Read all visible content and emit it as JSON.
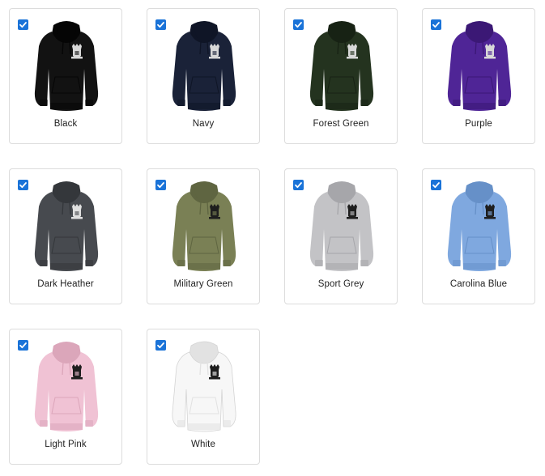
{
  "swatches": [
    {
      "label": "Black",
      "selected": true,
      "color": "#121212",
      "shade": "#050505",
      "logo": "#d8d8d8"
    },
    {
      "label": "Navy",
      "selected": true,
      "color": "#1a2238",
      "shade": "#0f1526",
      "logo": "#d8d8d8"
    },
    {
      "label": "Forest Green",
      "selected": true,
      "color": "#24331f",
      "shade": "#172214",
      "logo": "#d8d8d8"
    },
    {
      "label": "Purple",
      "selected": true,
      "color": "#4f2596",
      "shade": "#3b1875",
      "logo": "#d8d8d8"
    },
    {
      "label": "Dark Heather",
      "selected": true,
      "color": "#474a4f",
      "shade": "#34373b",
      "logo": "#e0e0e0"
    },
    {
      "label": "Military Green",
      "selected": true,
      "color": "#7a8055",
      "shade": "#5f6541",
      "logo": "#1e1e1e"
    },
    {
      "label": "Sport Grey",
      "selected": true,
      "color": "#c3c3c6",
      "shade": "#a6a6aa",
      "logo": "#1e1e1e"
    },
    {
      "label": "Carolina Blue",
      "selected": true,
      "color": "#7fa8df",
      "shade": "#6690c8",
      "logo": "#1e1e1e"
    },
    {
      "label": "Light Pink",
      "selected": true,
      "color": "#f0c2d4",
      "shade": "#dba6ba",
      "logo": "#1e1e1e"
    },
    {
      "label": "White",
      "selected": true,
      "color": "#f7f7f7",
      "shade": "#e2e2e2",
      "logo": "#1e1e1e"
    }
  ],
  "colors": {
    "checkbox": "#1a73d8",
    "border": "#dcdcdc"
  }
}
